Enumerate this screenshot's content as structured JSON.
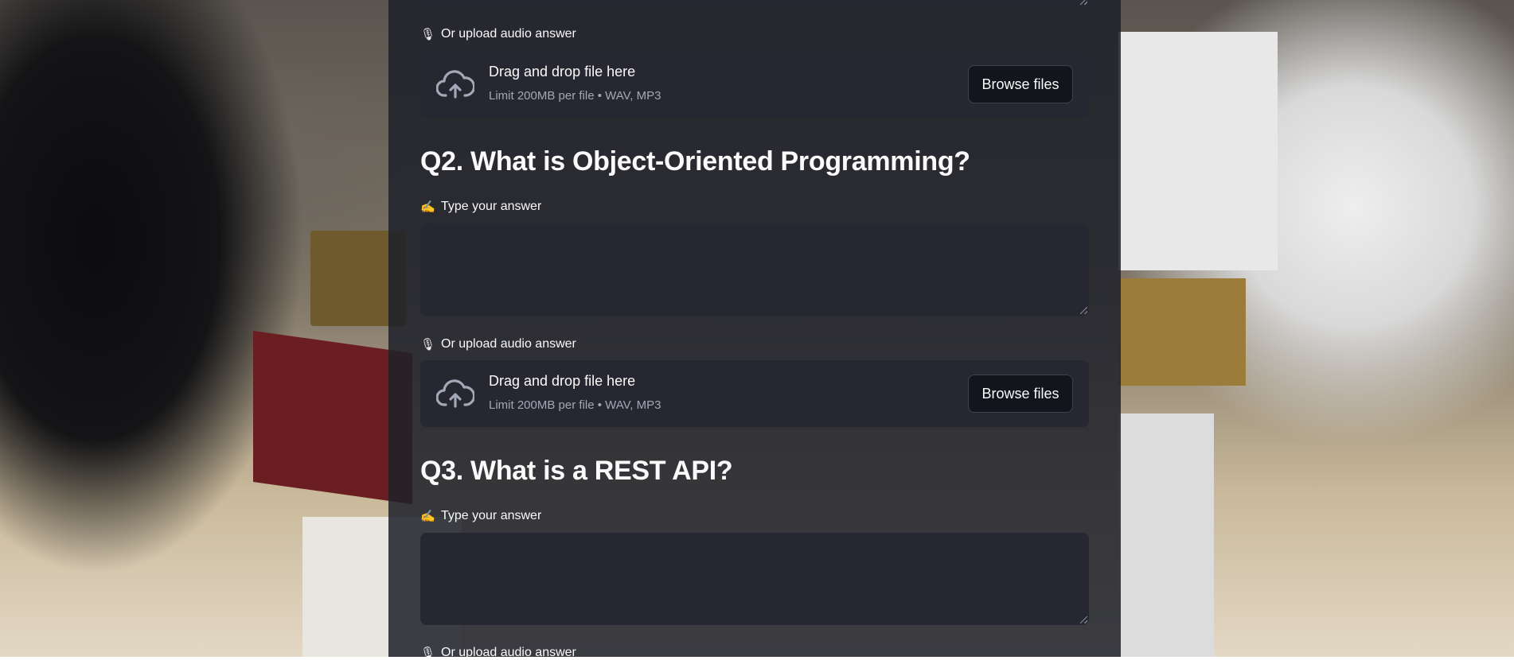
{
  "top_upload_label": "Or upload audio answer",
  "uploaders": {
    "title": "Drag and drop file here",
    "limit": "Limit 200MB per file • WAV, MP3",
    "browse_label": "Browse files"
  },
  "questions": [
    {
      "title": "Q2. What is Object-Oriented Programming?",
      "type_label": "Type your answer",
      "upload_label": "Or upload audio answer"
    },
    {
      "title": "Q3. What is a REST API?",
      "type_label": "Type your answer",
      "upload_label": "Or upload audio answer"
    }
  ],
  "icons": {
    "microphone": "microphone-icon",
    "writing_hand": "writing-hand-icon",
    "cloud_upload": "cloud-upload-icon"
  },
  "colors": {
    "panel": "#1e212a",
    "input_bg": "#262730",
    "text": "#fafafa",
    "muted": "#a3a8b8"
  }
}
